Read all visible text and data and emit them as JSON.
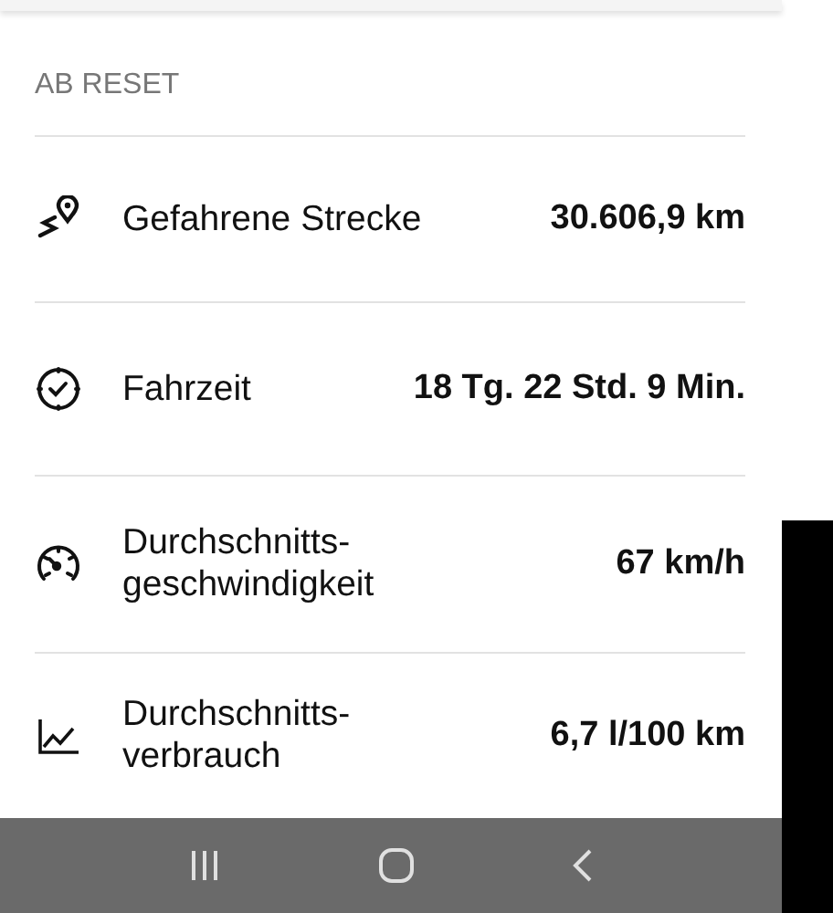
{
  "section": {
    "title": "AB RESET"
  },
  "stats": [
    {
      "kind": "distance",
      "label": "Gefahrene Strecke",
      "value": "30.606,9 km"
    },
    {
      "kind": "time",
      "label": "Fahrzeit",
      "value": "18 Tg. 22 Std. 9 Min."
    },
    {
      "kind": "speed",
      "label": "Durchschnitts-geschwindigkeit",
      "value": "67 km/h"
    },
    {
      "kind": "consumption",
      "label": "Durchschnitts-verbrauch",
      "value": "6,7 l/100 km"
    }
  ]
}
